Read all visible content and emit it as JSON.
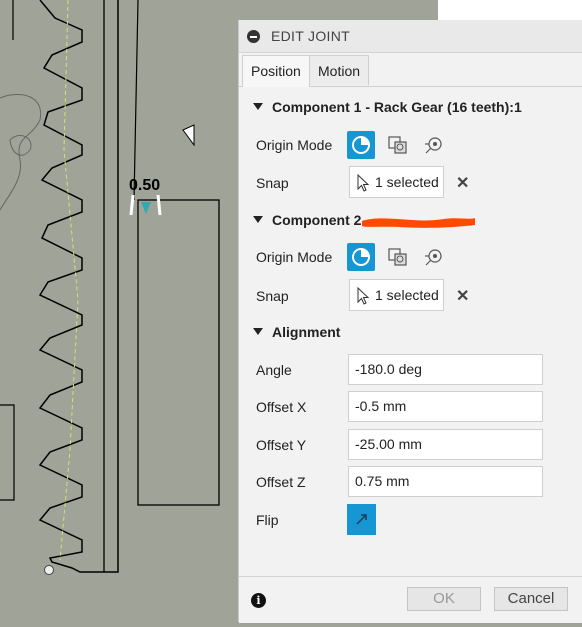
{
  "dialog": {
    "title": "EDIT JOINT",
    "tabs": [
      {
        "label": "Position",
        "active": true
      },
      {
        "label": "Motion",
        "active": false
      }
    ],
    "component1": {
      "heading": "Component 1 - Rack Gear (16 teeth):1",
      "origin_mode_label": "Origin Mode",
      "snap_label": "Snap",
      "snap_value": "1 selected"
    },
    "component2": {
      "heading": "Component 2",
      "origin_mode_label": "Origin Mode",
      "snap_label": "Snap",
      "snap_value": "1 selected"
    },
    "alignment": {
      "heading": "Alignment",
      "angle_label": "Angle",
      "angle_value": "-180.0 deg",
      "offset_x_label": "Offset X",
      "offset_x_value": "-0.5 mm",
      "offset_y_label": "Offset Y",
      "offset_y_value": "-25.00 mm",
      "offset_z_label": "Offset Z",
      "offset_z_value": "0.75 mm",
      "flip_label": "Flip"
    },
    "footer": {
      "ok_label": "OK",
      "cancel_label": "Cancel"
    }
  },
  "viewport": {
    "dimension_text": "0.50"
  },
  "colors": {
    "accent": "#1696d2",
    "redaction": "#ff4a00",
    "viewport_bg": "#a0a398"
  }
}
